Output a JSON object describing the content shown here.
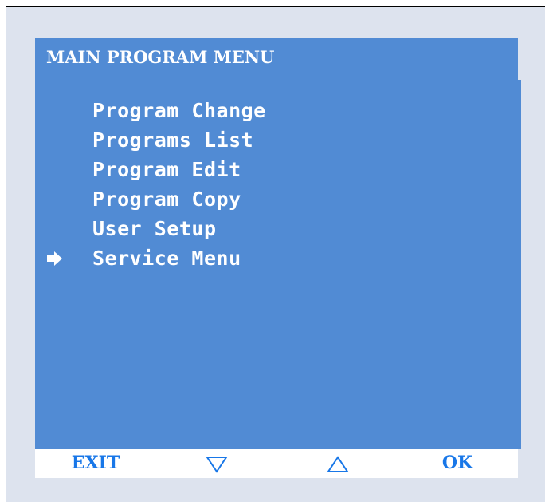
{
  "screen": {
    "title": "MAIN PROGRAM MENU",
    "selected_index": 5,
    "items": [
      {
        "label": "Program Change"
      },
      {
        "label": "Programs List"
      },
      {
        "label": "Program Edit"
      },
      {
        "label": "Program Copy"
      },
      {
        "label": "User Setup"
      },
      {
        "label": "Service Menu"
      }
    ],
    "cursor_icon": "right-arrow-icon"
  },
  "softkeys": {
    "exit_label": "EXIT",
    "down_icon": "down-triangle-icon",
    "up_icon": "up-triangle-icon",
    "ok_label": "OK"
  },
  "colors": {
    "screen_background": "#518bd4",
    "menu_text": "#ffffff",
    "softkey_text": "#1877e8",
    "frame_background": "#dde3ee"
  }
}
